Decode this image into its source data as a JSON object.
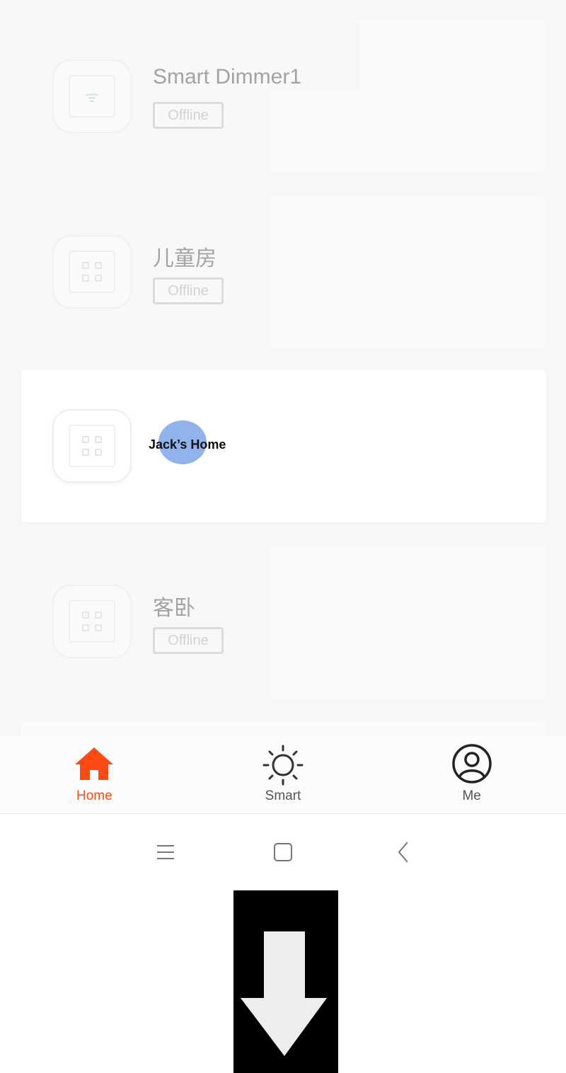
{
  "devices": [
    {
      "name": "Smart Dimmer1",
      "status": "Offline",
      "icon": "wifi-plug-icon"
    },
    {
      "name": "儿童房",
      "status": "Offline",
      "icon": "switch-panel-icon"
    },
    {
      "name": "Jack’s Home",
      "status": "",
      "icon": "switch-panel-icon"
    },
    {
      "name": "客卧",
      "status": "Offline",
      "icon": "switch-panel-icon"
    }
  ],
  "tabs": {
    "home": {
      "label": "Home",
      "icon": "home-icon"
    },
    "smart": {
      "label": "Smart",
      "icon": "sun-icon"
    },
    "me": {
      "label": "Me",
      "icon": "user-circle-icon"
    }
  },
  "system_nav": {
    "icons": [
      "menu-icon",
      "home-square-icon",
      "back-icon"
    ]
  },
  "colors": {
    "accent": "#ff4a14",
    "touch_indicator": "#8fb3ea",
    "offline_text": "#cfcfcf",
    "overlay_arrow": "#eeeeee"
  },
  "overlay": {
    "icon": "down-arrow-icon"
  }
}
